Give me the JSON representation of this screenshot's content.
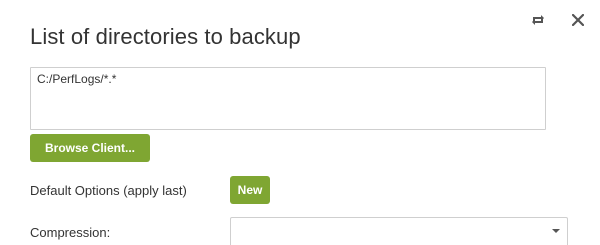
{
  "dialog": {
    "title": "List of directories to backup",
    "icons": {
      "refresh": "refresh-icon",
      "close": "close-icon"
    }
  },
  "directories": {
    "value": "C:/PerfLogs/*.*"
  },
  "buttons": {
    "browse_label": "Browse Client...",
    "new_label": "New"
  },
  "options": {
    "default_label": "Default Options (apply last)",
    "compression_label": "Compression:",
    "compression_value": ""
  },
  "colors": {
    "accent": "#7fa632",
    "text": "#333333",
    "border": "#cfcfcf"
  }
}
